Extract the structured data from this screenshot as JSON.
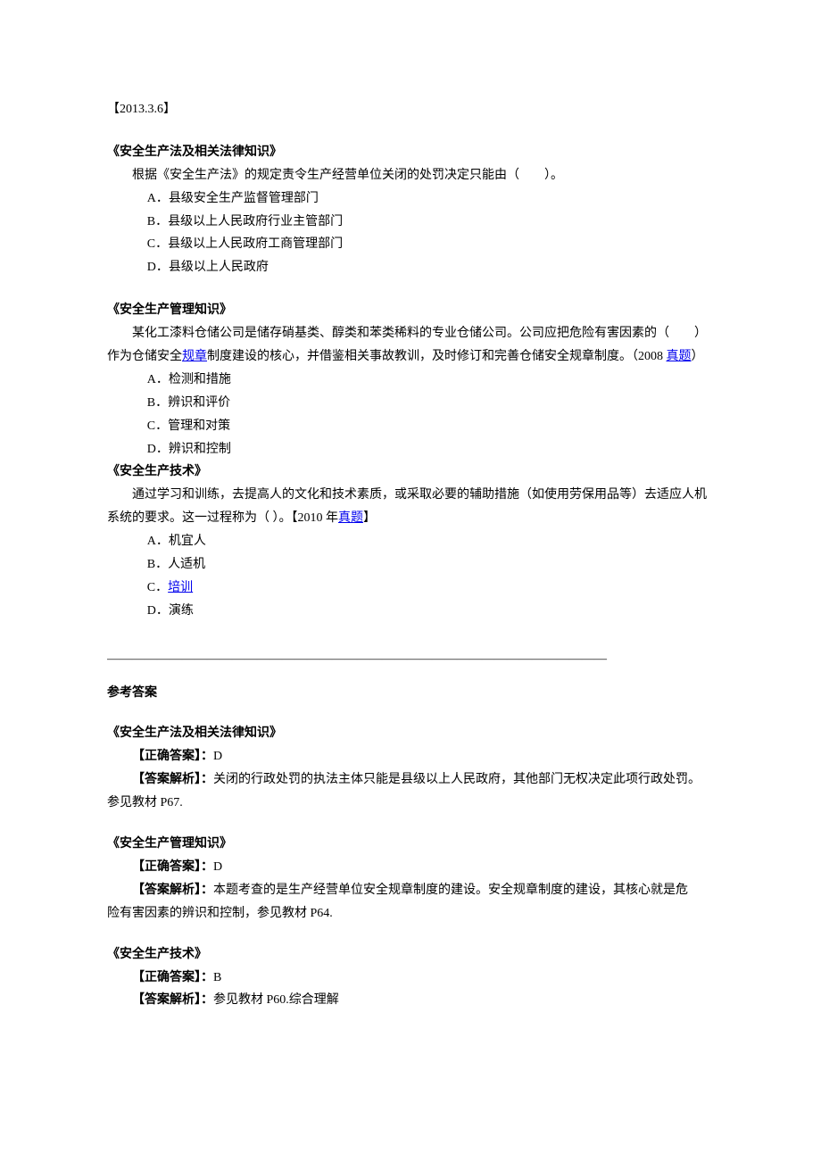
{
  "date_tag": "【2013.3.6】",
  "q1": {
    "title": "《安全生产法及相关法律知识》",
    "stem": "根据《安全生产法》的规定责令生产经营单位关闭的处罚决定只能由（　　）。",
    "optA": "A．县级安全生产监督管理部门",
    "optB": "B．县级以上人民政府行业主管部门",
    "optC": "C．县级以上人民政府工商管理部门",
    "optD": "D．县级以上人民政府"
  },
  "q2": {
    "title": "《安全生产管理知识》",
    "stem_a": "某化工漆料仓储公司是储存硝基类、醇类和苯类稀料的专业仓储公司。公司应把危险有害因素的（　　）作为仓储安全",
    "link1": "规章",
    "stem_b": "制度建设的核心，并借鉴相关事故教训，及时修订和完善仓储安全规章制度。（2008 ",
    "link2": "真题",
    "stem_c": "）",
    "optA": "A．检测和措施",
    "optB": "B．辨识和评价",
    "optC": "C．管理和对策",
    "optD": "D．辨识和控制"
  },
  "q3": {
    "title": "《安全生产技术》",
    "stem_a": "通过学习和训练，去提高人的文化和技术素质，或采取必要的辅助措施（如使用劳保用品等）去适应人机系统的要求。这一过程称为（  ）。【2010 年",
    "link1": "真题",
    "stem_b": "】",
    "optA": "A．机宜人",
    "optB": "B．人适机",
    "optC_pre": "C．",
    "optC_link": "培训",
    "optD": "D．演练"
  },
  "hr": "————————————————————————————————————————",
  "answers_heading": "参考答案",
  "a1": {
    "title": "《安全生产法及相关法律知识》",
    "correct_label": "【正确答案】：",
    "correct_val": "D",
    "analysis_label": "【答案解析】：",
    "analysis_val_a": "关闭的行政处罚的执法主体只能是县级以上人民政府，其他部门无权决定此项行政处罚。",
    "analysis_val_b": "参见教材 P67."
  },
  "a2": {
    "title": "《安全生产管理知识》",
    "correct_label": "【正确答案】：",
    "correct_val": "D",
    "analysis_label": "【答案解析】：",
    "analysis_val_a": "本题考查的是生产经营单位安全规章制度的建设。安全规章制度的建设，其核心就是危",
    "analysis_val_b": "险有害因素的辨识和控制，参见教材 P64."
  },
  "a3": {
    "title": "《安全生产技术》",
    "correct_label": "【正确答案】：",
    "correct_val": "B",
    "analysis_label": "【答案解析】：",
    "analysis_val": "参见教材 P60.综合理解"
  }
}
